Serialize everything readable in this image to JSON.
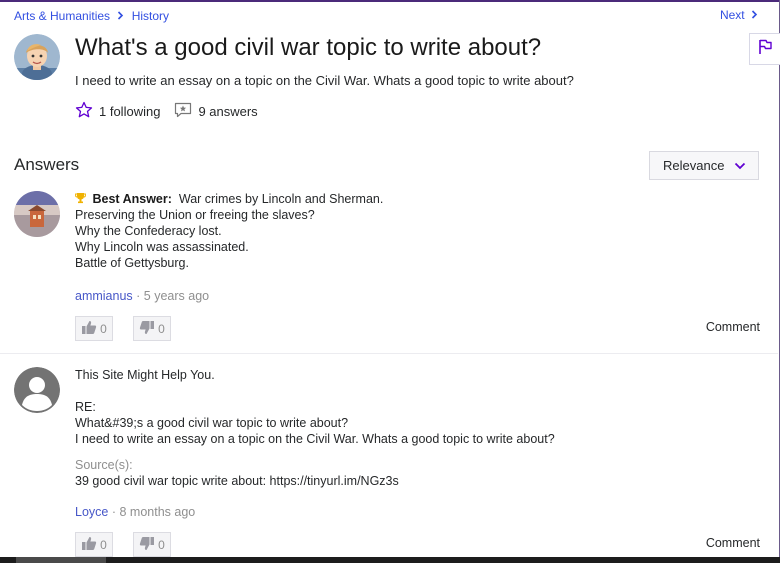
{
  "breadcrumb": {
    "category": "Arts & Humanities",
    "subcategory": "History"
  },
  "nav": {
    "next_label": "Next"
  },
  "question": {
    "title": "What's a good civil war topic to write about?",
    "body": "I need to write an essay on a topic on the Civil War. Whats a good topic to write about?",
    "following": "1 following",
    "answers_count": "9 answers"
  },
  "answers_section": {
    "heading": "Answers",
    "sort_label": "Relevance"
  },
  "answers": [
    {
      "best_label": "Best Answer:",
      "lines": [
        "War crimes by Lincoln and Sherman.",
        "Preserving the Union or freeing the slaves?",
        "Why the Confederacy lost.",
        "Why Lincoln was assassinated.",
        "Battle of Gettysburg."
      ],
      "author": "ammianus",
      "time": "5 years ago",
      "upvotes": "0",
      "downvotes": "0",
      "comment_label": "Comment"
    },
    {
      "lines": [
        "This Site Might Help You.",
        "",
        "RE:",
        "What&#39;s a good civil war topic to write about?",
        "I need to write an essay on a topic on the Civil War. Whats a good topic to write about?"
      ],
      "source_label": "Source(s):",
      "source_text": "39 good civil war topic write about: https://tinyurl.im/NGz3s",
      "author": "Loyce",
      "time": "8 months ago",
      "upvotes": "0",
      "downvotes": "0",
      "comment_label": "Comment"
    }
  ],
  "icons": {
    "breadcrumb_sep": "chevron-right-icon",
    "next": "chevron-right-icon",
    "flag": "flag-icon",
    "following": "star-outline-icon",
    "answers": "answers-icon",
    "best": "trophy-icon",
    "sort": "chevron-down-icon",
    "upvote": "thumbs-up-icon",
    "downvote": "thumbs-down-icon"
  },
  "colors": {
    "link": "#324fe1",
    "accent": "#6001d2",
    "trophy": "#f0b200",
    "muted": "#8f8f8f"
  }
}
